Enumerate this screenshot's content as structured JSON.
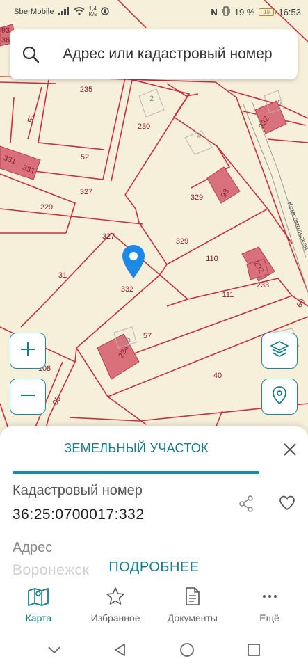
{
  "status_bar": {
    "carrier": "SberMobile",
    "speed_value": "1,4",
    "speed_unit": "K/s",
    "battery_percent": "19 %",
    "battery_level": "19",
    "time": "16:53"
  },
  "search": {
    "placeholder": "Адрес или кадастровый номер",
    "icon": "search-icon"
  },
  "map": {
    "labels": [
      {
        "text": "235",
        "style": "red"
      },
      {
        "text": "2",
        "style": "grey"
      },
      {
        "text": "230",
        "style": "red"
      },
      {
        "text": "4",
        "style": "grey"
      },
      {
        "text": "5",
        "style": "grey"
      },
      {
        "text": "332",
        "style": "rot"
      },
      {
        "text": "51",
        "style": "red"
      },
      {
        "text": "52",
        "style": "red"
      },
      {
        "text": "331",
        "style": "red"
      },
      {
        "text": "331",
        "style": "red"
      },
      {
        "text": "327",
        "style": "red"
      },
      {
        "text": "229",
        "style": "red"
      },
      {
        "text": "329",
        "style": "red"
      },
      {
        "text": "93",
        "style": "rot"
      },
      {
        "text": "Комсомольская",
        "style": "street"
      },
      {
        "text": "327",
        "style": "red"
      },
      {
        "text": "329",
        "style": "red"
      },
      {
        "text": "110",
        "style": "red"
      },
      {
        "text": "232",
        "style": "rot"
      },
      {
        "text": "31",
        "style": "red"
      },
      {
        "text": "332",
        "style": "red"
      },
      {
        "text": "111",
        "style": "red"
      },
      {
        "text": "233",
        "style": "red"
      },
      {
        "text": "60",
        "style": "rot"
      },
      {
        "text": "57",
        "style": "red"
      },
      {
        "text": "2а",
        "style": "grey"
      },
      {
        "text": "234",
        "style": "rot"
      },
      {
        "text": "108",
        "style": "red"
      },
      {
        "text": "40",
        "style": "red"
      },
      {
        "text": "95",
        "style": "rot"
      },
      {
        "text": "36",
        "style": "red"
      },
      {
        "text": "93",
        "style": "red"
      }
    ],
    "zoom_in_icon": "plus-icon",
    "zoom_out_icon": "minus-icon",
    "layers_icon": "layers-icon",
    "location_icon": "location-icon",
    "pin_icon": "map-pin-icon",
    "colors": {
      "parcel_line": "#c8303f",
      "building": "#d9717a",
      "pin": "#1e88e5"
    }
  },
  "sheet": {
    "title": "ЗЕМЕЛЬНЫЙ УЧАСТОК",
    "cadastral_label": "Кадастровый номер",
    "cadastral_value": "36:25:0700017:332",
    "address_label": "Адрес",
    "address_value": "Воронежск",
    "more_button": "ПОДРОБНЕЕ"
  },
  "tabs": [
    {
      "label": "Карта",
      "icon": "map-icon",
      "active": true
    },
    {
      "label": "Избранное",
      "icon": "star-icon",
      "active": false
    },
    {
      "label": "Документы",
      "icon": "document-icon",
      "active": false
    },
    {
      "label": "Ещё",
      "icon": "more-icon",
      "active": false
    }
  ],
  "colors": {
    "accent": "#167d8c",
    "accent_border": "#1a8aa0"
  }
}
